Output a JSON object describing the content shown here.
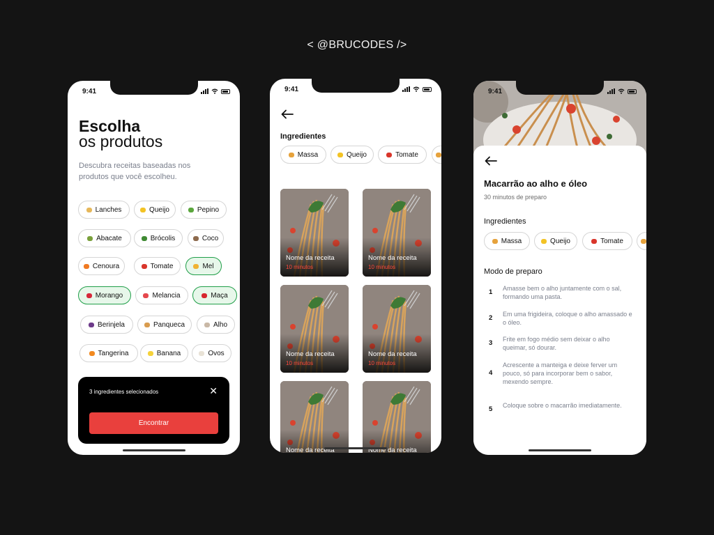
{
  "brand": "< @BRUCODES />",
  "status_time": "9:41",
  "screen1": {
    "title_bold": "Escolha",
    "title_light": "os produtos",
    "subtitle": "Descubra receitas baseadas nos produtos que você escolheu.",
    "chips": [
      {
        "label": "Lanches",
        "color": "#e6b75a",
        "selected": false
      },
      {
        "label": "Queijo",
        "color": "#f3c325",
        "selected": false
      },
      {
        "label": "Pepino",
        "color": "#5aa63c",
        "selected": false
      },
      {
        "label": "Abacate",
        "color": "#7aa03b",
        "selected": false
      },
      {
        "label": "Brócolis",
        "color": "#3f8a33",
        "selected": false
      },
      {
        "label": "Coco",
        "color": "#8d6a4d",
        "selected": false
      },
      {
        "label": "Cenoura",
        "color": "#f07a22",
        "selected": false
      },
      {
        "label": "Tomate",
        "color": "#d9352b",
        "selected": false
      },
      {
        "label": "Mel",
        "color": "#f0b232",
        "selected": true
      },
      {
        "label": "Morango",
        "color": "#d6283b",
        "selected": true
      },
      {
        "label": "Melancia",
        "color": "#e5484d",
        "selected": false
      },
      {
        "label": "Maça",
        "color": "#d7262f",
        "selected": true
      },
      {
        "label": "Berinjela",
        "color": "#6d3b8a",
        "selected": false
      },
      {
        "label": "Panqueca",
        "color": "#d99c4f",
        "selected": false
      },
      {
        "label": "Alho",
        "color": "#c9b8a6",
        "selected": false
      },
      {
        "label": "Tangerina",
        "color": "#f28a20",
        "selected": false
      },
      {
        "label": "Banana",
        "color": "#f5d23a",
        "selected": false
      },
      {
        "label": "Ovos",
        "color": "#e8e2d6",
        "selected": false
      }
    ],
    "sheet_text": "3 ingredientes selecionados",
    "find_button": "Encontrar"
  },
  "screen2": {
    "section_label": "Ingredientes",
    "chips": [
      {
        "label": "Massa",
        "color": "#e6a23c"
      },
      {
        "label": "Queijo",
        "color": "#f3c325"
      },
      {
        "label": "Tomate",
        "color": "#d9352b"
      }
    ],
    "cards": [
      {
        "name": "Nome da receita",
        "minutes": "10 minutos"
      },
      {
        "name": "Nome da receita",
        "minutes": "10 minutos"
      },
      {
        "name": "Nome da receita",
        "minutes": "10 minutos"
      },
      {
        "name": "Nome da receita",
        "minutes": "10 minutos"
      },
      {
        "name": "Nome da receita",
        "minutes": ""
      },
      {
        "name": "Nome da receita",
        "minutes": ""
      }
    ]
  },
  "screen3": {
    "title": "Macarrão ao alho e óleo",
    "prep_time": "30 minutos de preparo",
    "ingredients_label": "Ingredientes",
    "chips": [
      {
        "label": "Massa",
        "color": "#e6a23c"
      },
      {
        "label": "Queijo",
        "color": "#f3c325"
      },
      {
        "label": "Tomate",
        "color": "#d9352b"
      }
    ],
    "method_label": "Modo de preparo",
    "steps": [
      {
        "n": "1",
        "text": "Amasse bem o alho juntamente com o sal, formando uma pasta."
      },
      {
        "n": "2",
        "text": "Em uma frigideira, coloque o alho amassado e o óleo."
      },
      {
        "n": "3",
        "text": "Frite em fogo médio sem deixar o alho queimar, só dourar."
      },
      {
        "n": "4",
        "text": "Acrescente a manteiga e deixe ferver um pouco, só para incorporar bem o sabor, mexendo sempre."
      },
      {
        "n": "5",
        "text": "Coloque sobre o macarrão imediatamente."
      }
    ]
  }
}
